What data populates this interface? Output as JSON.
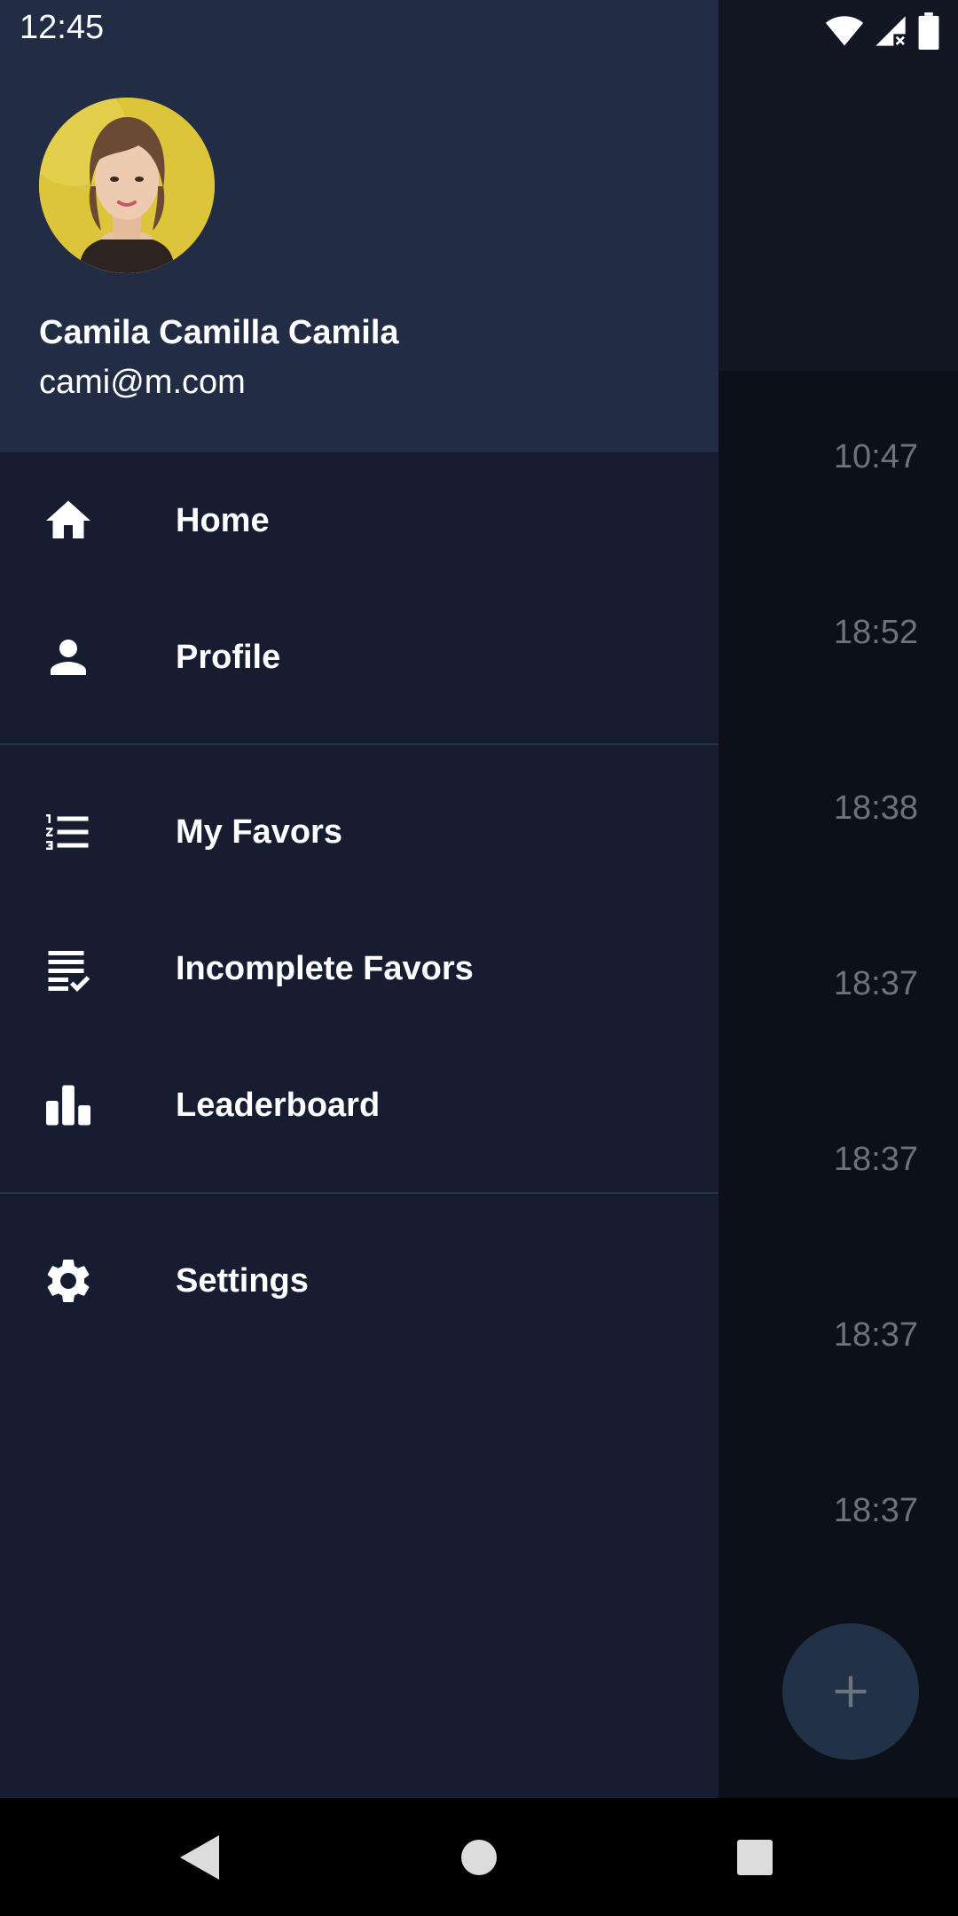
{
  "status_bar": {
    "time": "12:45",
    "icons": [
      "wifi-icon",
      "signal-icon",
      "battery-icon"
    ]
  },
  "drawer": {
    "user": {
      "name": "Camila Camilla Camila",
      "email": "cami@m.com",
      "avatar": "avatar-photo"
    },
    "sections": [
      [
        {
          "label": "Home",
          "icon": "home-icon"
        },
        {
          "label": "Profile",
          "icon": "person-icon"
        }
      ],
      [
        {
          "label": "My Favors",
          "icon": "numbered-list-icon"
        },
        {
          "label": "Incomplete Favors",
          "icon": "checklist-icon"
        },
        {
          "label": "Leaderboard",
          "icon": "bar-chart-icon"
        }
      ],
      [
        {
          "label": "Settings",
          "icon": "gear-icon"
        }
      ]
    ]
  },
  "background_list": {
    "times": [
      "10:47",
      "18:52",
      "18:38",
      "18:37",
      "18:37",
      "18:37",
      "18:37"
    ]
  },
  "fab": {
    "icon": "plus-icon"
  },
  "nav_bar": {
    "buttons": [
      "back-icon",
      "home-circle-icon",
      "recents-icon"
    ]
  },
  "colors": {
    "drawer_bg": "#161d30",
    "drawer_header_bg": "#222c45",
    "scrim_bg": "#0c1019",
    "fab_bg": "#223246",
    "text_primary": "#ffffff",
    "text_dimmed": "#6e727a"
  }
}
